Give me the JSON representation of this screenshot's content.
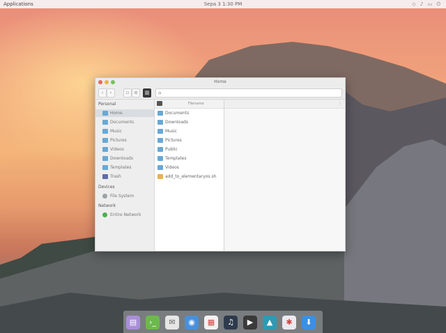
{
  "topbar": {
    "applications_label": "Applications",
    "clock": "Sepa 3  1:30 PM",
    "tray_icons": [
      "network-icon",
      "volume-icon",
      "battery-icon",
      "power-icon"
    ]
  },
  "window": {
    "title": "Home",
    "toolbar": {
      "back_icon": "chevron-left-icon",
      "forward_icon": "chevron-right-icon",
      "path_icon": "home-icon"
    },
    "sidebar": {
      "sections": [
        {
          "header": "Personal",
          "items": [
            {
              "label": "Home",
              "icon": "home-folder-icon",
              "selected": true
            },
            {
              "label": "Documents",
              "icon": "folder-icon"
            },
            {
              "label": "Music",
              "icon": "folder-icon"
            },
            {
              "label": "Pictures",
              "icon": "folder-icon"
            },
            {
              "label": "Videos",
              "icon": "folder-icon"
            },
            {
              "label": "Downloads",
              "icon": "folder-icon"
            },
            {
              "label": "Templates",
              "icon": "folder-icon"
            },
            {
              "label": "Trash",
              "icon": "trash-icon"
            }
          ]
        },
        {
          "header": "Devices",
          "items": [
            {
              "label": "File System",
              "icon": "disk-icon"
            }
          ]
        },
        {
          "header": "Network",
          "items": [
            {
              "label": "Entire Network",
              "icon": "network-icon"
            }
          ]
        }
      ]
    },
    "filelist": {
      "column_header": "Filename",
      "items": [
        {
          "name": "Documents",
          "type": "folder"
        },
        {
          "name": "Downloads",
          "type": "folder"
        },
        {
          "name": "Music",
          "type": "folder"
        },
        {
          "name": "Pictures",
          "type": "folder"
        },
        {
          "name": "Public",
          "type": "folder"
        },
        {
          "name": "Templates",
          "type": "folder"
        },
        {
          "name": "Videos",
          "type": "folder"
        },
        {
          "name": "add_to_elementaryos.sh",
          "type": "file"
        }
      ]
    }
  },
  "dock": {
    "apps": [
      {
        "name": "files-icon",
        "color": "#a98fd6"
      },
      {
        "name": "terminal-icon",
        "color": "#6cb94b"
      },
      {
        "name": "mail-icon",
        "color": "#e6e6e6"
      },
      {
        "name": "browser-icon",
        "color": "#4a8fd9"
      },
      {
        "name": "calendar-icon",
        "color": "#f2f2f2"
      },
      {
        "name": "music-icon",
        "color": "#2e3b4d"
      },
      {
        "name": "video-icon",
        "color": "#3a3a3a"
      },
      {
        "name": "photos-icon",
        "color": "#2d9bb3"
      },
      {
        "name": "settings-icon",
        "color": "#e9e9ef"
      },
      {
        "name": "app-center-icon",
        "color": "#3d8fe0"
      }
    ]
  }
}
